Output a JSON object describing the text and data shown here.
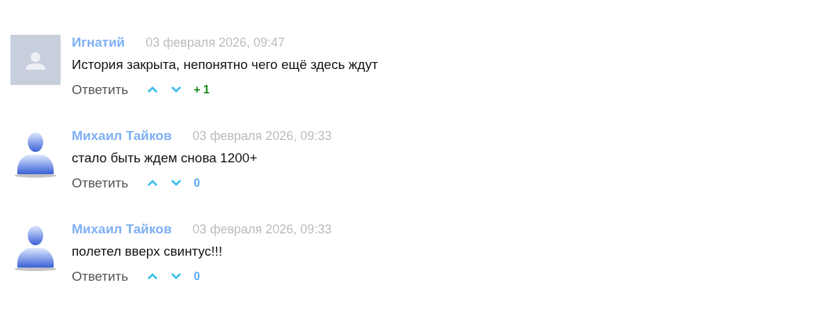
{
  "comments": [
    {
      "avatar": {
        "kind": "placeholder"
      },
      "author": "Игнатий",
      "date": "03 февраля 2026, 09:47",
      "text": "История закрыта, непонятно чего ещё здесь ждут",
      "reply": "Ответить",
      "score": {
        "text": "+ 1",
        "color": "#138a13"
      }
    },
    {
      "avatar": {
        "kind": "figure"
      },
      "author": "Михаил Тайков",
      "date": "03 февраля 2026, 09:33",
      "text": "стало быть ждем снова 1200+",
      "reply": "Ответить",
      "score": {
        "text": "0",
        "color": "#5aa8f0"
      }
    },
    {
      "avatar": {
        "kind": "figure"
      },
      "author": "Михаил Тайков",
      "date": "03 февраля 2026, 09:33",
      "text": "полетел вверх свинтус!!!",
      "reply": "Ответить",
      "score": {
        "text": "0",
        "color": "#5aa8f0"
      }
    }
  ]
}
